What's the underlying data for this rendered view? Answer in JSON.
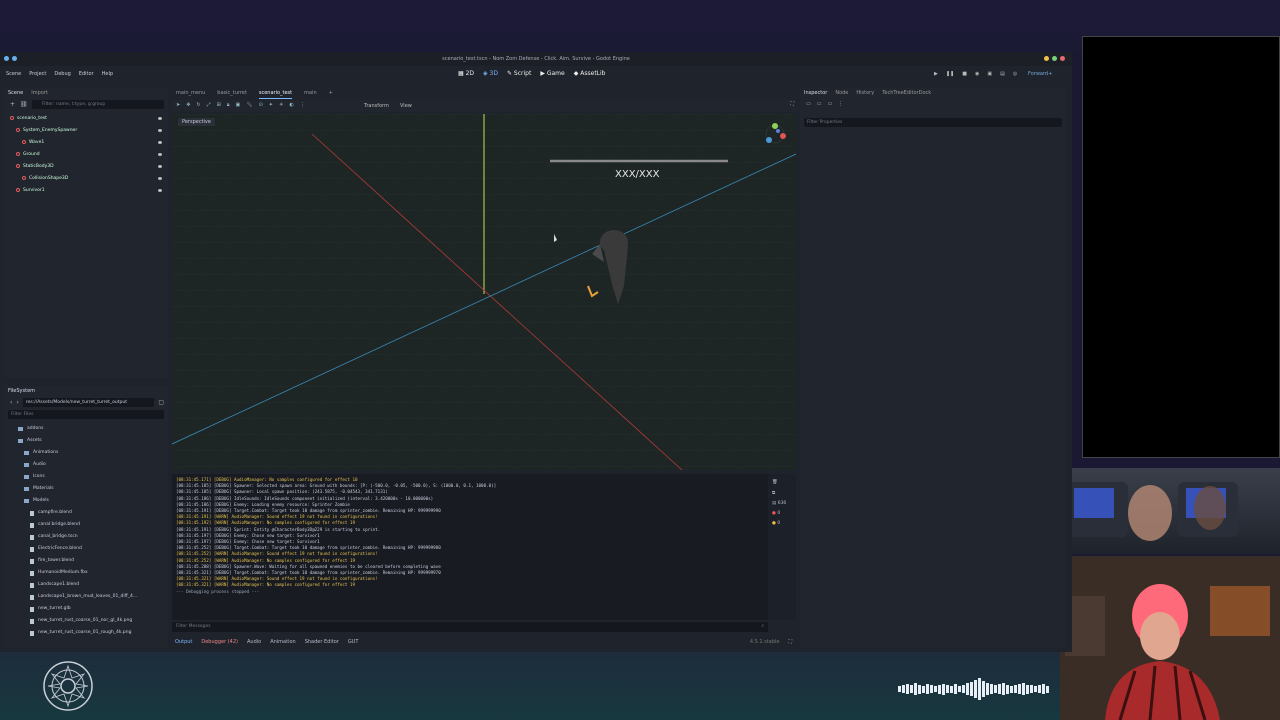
{
  "window": {
    "title": "scenario_test.tscn - Nom Zom Defense - Click. Aim. Survive - Godot Engine"
  },
  "menu": [
    "Scene",
    "Project",
    "Debug",
    "Editor",
    "Help"
  ],
  "modes": [
    "2D",
    "3D",
    "Script",
    "Game",
    "AssetLib"
  ],
  "renderer": "Forward+",
  "scene_panel": {
    "tabs": [
      "Scene",
      "Import"
    ],
    "filter_placeholder": "Filter: name, t:type, g:group",
    "nodes": [
      {
        "name": "scenario_test",
        "color": "#e05a5a"
      },
      {
        "name": "System_EnemySpawner",
        "color": "#e05a5a"
      },
      {
        "name": "Wave1",
        "color": "#e05a5a"
      },
      {
        "name": "Ground",
        "color": "#e05a5a"
      },
      {
        "name": "StaticBody3D",
        "color": "#e05a5a"
      },
      {
        "name": "CollisionShape3D",
        "color": "#e05a5a"
      },
      {
        "name": "Survivor1",
        "color": "#e05a5a"
      }
    ]
  },
  "filesystem": {
    "title": "FileSystem",
    "path": "res://Assets/Models/new_turret_turret_output",
    "filter_placeholder": "Filter Files",
    "items": [
      {
        "name": "addons",
        "type": "folder"
      },
      {
        "name": "Assets",
        "type": "folder"
      },
      {
        "name": "Animations",
        "type": "folder"
      },
      {
        "name": "Audio",
        "type": "folder"
      },
      {
        "name": "Icons",
        "type": "folder"
      },
      {
        "name": "Materials",
        "type": "folder"
      },
      {
        "name": "Models",
        "type": "folder"
      },
      {
        "name": "campfire.blend",
        "type": "file"
      },
      {
        "name": "canal bridge.blend",
        "type": "file"
      },
      {
        "name": "canal_bridge.tscn",
        "type": "file"
      },
      {
        "name": "ElectricFence.blend",
        "type": "file"
      },
      {
        "name": "fire_tower.blend",
        "type": "file"
      },
      {
        "name": "HumanoidMedium.fbx",
        "type": "file"
      },
      {
        "name": "Landscape1.blend",
        "type": "file"
      },
      {
        "name": "Landscape1_brown_mud_leaves_01_diff_4...",
        "type": "file"
      },
      {
        "name": "new_turret.glb",
        "type": "file"
      },
      {
        "name": "new_turret_rust_coarse_01_nor_gl_4k.png",
        "type": "file"
      },
      {
        "name": "new_turret_rust_coarse_01_rough_4k.png",
        "type": "file"
      }
    ]
  },
  "scene_tabs": [
    "main_menu",
    "basic_turret",
    "scenario_test",
    "main"
  ],
  "viewport": {
    "perspective_label": "Perspective",
    "toolbar": [
      "Transform",
      "View"
    ],
    "health_text": "XXX/XXX"
  },
  "console": {
    "lines": [
      {
        "text": "[08:31:45.171] [DEBUG] AudioManager: No samples configured for effect 10",
        "level": "warn"
      },
      {
        "text": "[08:31:45.185] [DEBUG] Spawner: Selected spawn area: Ground with bounds: [P: (-500.0, -0.05, -500.0), S: (1000.0, 0.1, 1000.0)]",
        "level": "debug"
      },
      {
        "text": "[08:31:45.185] [DEBUG] Spawner: Local spawn position: (243.5875, -0.04543, 341.7131)",
        "level": "debug"
      },
      {
        "text": "[08:31:45.186] [DEBUG] IdleSounds: IdleSounds component initialized (interval: 3.420000s - 10.000000s)",
        "level": "debug"
      },
      {
        "text": "[08:31:45.186] [DEBUG] Enemy: Loading enemy resource: Sprinter Zombie",
        "level": "debug"
      },
      {
        "text": "[08:31:45.191] [DEBUG] Target.Combat: Target took 10 damage from sprinter_zombie. Remaining HP: 999999990",
        "level": "debug"
      },
      {
        "text": "[08:31:45.191] [WARN] AudioManager: Sound effect 19 not found in configurations!",
        "level": "warn"
      },
      {
        "text": "[08:31:45.192] [WARN] AudioManager: No samples configured for effect 19",
        "level": "warn"
      },
      {
        "text": "[08:31:45.191] [DEBUG] Sprint: Entity @CharacterBody3D@229 is starting to sprint.",
        "level": "debug"
      },
      {
        "text": "[08:31:45.197] [DEBUG] Enemy: Chose new target: Survivor1",
        "level": "debug"
      },
      {
        "text": "[08:31:45.197] [DEBUG] Enemy: Chose new target: Survivor1",
        "level": "debug"
      },
      {
        "text": "[08:31:45.252] [DEBUG] Target.Combat: Target took 10 damage from sprinter_zombie. Remaining HP: 999999980",
        "level": "debug"
      },
      {
        "text": "[08:31:45.252] [WARN] AudioManager: Sound effect 19 not found in configurations!",
        "level": "warn"
      },
      {
        "text": "[08:31:45.252] [WARN] AudioManager: No samples configured for effect 19",
        "level": "warn"
      },
      {
        "text": "[08:31:45.288] [DEBUG] Spawner.Wave: Waiting for all spawned enemies to be cleared before completing wave",
        "level": "debug"
      },
      {
        "text": "[08:31:45.321] [DEBUG] Target.Combat: Target took 10 damage from sprinter_zombie. Remaining HP: 999999970",
        "level": "debug"
      },
      {
        "text": "[08:31:45.321] [WARN] AudioManager: Sound effect 19 not found in configurations!",
        "level": "warn"
      },
      {
        "text": "[08:31:45.321] [WARN] AudioManager: No samples configured for effect 19",
        "level": "warn"
      },
      {
        "text": "--- Debugging process stopped ---",
        "level": "err"
      }
    ],
    "filter_placeholder": "Filter Messages",
    "counts": {
      "messages": "636",
      "errors": "0",
      "warnings": "0"
    }
  },
  "bottom_tabs": [
    "Output",
    "Debugger (42)",
    "Audio",
    "Animation",
    "Shader Editor",
    "GUT"
  ],
  "version": "4.5.1.stable",
  "inspector": {
    "tabs": [
      "Inspector",
      "Node",
      "History",
      "TechTreeEditorDock"
    ],
    "filter_placeholder": "Filter Properties"
  }
}
